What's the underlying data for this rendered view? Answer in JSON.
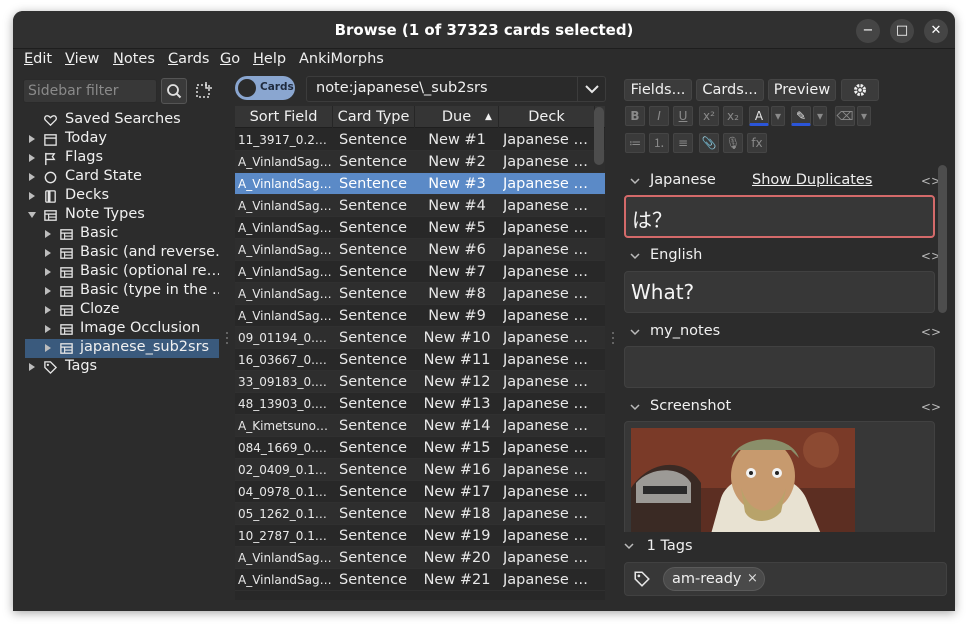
{
  "window": {
    "title": "Browse (1 of 37323 cards selected)",
    "controls": {
      "minimize": "−",
      "maximize": "□",
      "close": "✕"
    }
  },
  "menubar": [
    {
      "first": "E",
      "rest": "dit"
    },
    {
      "first": "V",
      "rest": "iew"
    },
    {
      "first": "N",
      "rest": "otes"
    },
    {
      "first": "C",
      "rest": "ards"
    },
    {
      "first": "G",
      "rest": "o"
    },
    {
      "first": "H",
      "rest": "elp"
    },
    {
      "first": "",
      "rest": "AnkiMorphs"
    }
  ],
  "sidebar": {
    "filter_placeholder": "Sidebar filter",
    "items": [
      {
        "label": "Saved Searches",
        "icon": "heart-icon",
        "level": 0,
        "expander": false
      },
      {
        "label": "Today",
        "icon": "calendar-icon",
        "level": 0,
        "expander": true
      },
      {
        "label": "Flags",
        "icon": "flag-icon",
        "level": 0,
        "expander": true
      },
      {
        "label": "Card State",
        "icon": "circle-icon",
        "level": 0,
        "expander": true
      },
      {
        "label": "Decks",
        "icon": "deck-icon",
        "level": 0,
        "expander": true
      },
      {
        "label": "Note Types",
        "icon": "notetype-icon",
        "level": 0,
        "expander": true,
        "expanded": true
      },
      {
        "label": "Basic",
        "icon": "notetype-icon",
        "level": 1,
        "expander": true
      },
      {
        "label": "Basic (and reverse…",
        "icon": "notetype-icon",
        "level": 1,
        "expander": true
      },
      {
        "label": "Basic (optional re…",
        "icon": "notetype-icon",
        "level": 1,
        "expander": true
      },
      {
        "label": "Basic (type in the …",
        "icon": "notetype-icon",
        "level": 1,
        "expander": true
      },
      {
        "label": "Cloze",
        "icon": "notetype-icon",
        "level": 1,
        "expander": true
      },
      {
        "label": "Image Occlusion",
        "icon": "notetype-icon",
        "level": 1,
        "expander": true
      },
      {
        "label": "japanese_sub2srs",
        "icon": "notetype-icon",
        "level": 1,
        "expander": true,
        "selected": true
      },
      {
        "label": "Tags",
        "icon": "tag-icon",
        "level": 0,
        "expander": true
      }
    ]
  },
  "toolbar": {
    "mode_toggle": "Cards",
    "search_value": "note:japanese\\_sub2srs"
  },
  "table": {
    "columns": [
      "Sort Field",
      "Card Type",
      "Due",
      "Deck"
    ],
    "sort_indicator": "▲",
    "rows": [
      {
        "sort": "11_3917_0.20....",
        "type": "Sentence",
        "due": "New #1",
        "deck": "Japanese …"
      },
      {
        "sort": "A_VinlandSag…",
        "type": "Sentence",
        "due": "New #2",
        "deck": "Japanese …"
      },
      {
        "sort": "A_VinlandSag…",
        "type": "Sentence",
        "due": "New #3",
        "deck": "Japanese …",
        "selected": true
      },
      {
        "sort": "A_VinlandSag…",
        "type": "Sentence",
        "due": "New #4",
        "deck": "Japanese …"
      },
      {
        "sort": "A_VinlandSag…",
        "type": "Sentence",
        "due": "New #5",
        "deck": "Japanese …"
      },
      {
        "sort": "A_VinlandSag…",
        "type": "Sentence",
        "due": "New #6",
        "deck": "Japanese …"
      },
      {
        "sort": "A_VinlandSag…",
        "type": "Sentence",
        "due": "New #7",
        "deck": "Japanese …"
      },
      {
        "sort": "A_VinlandSag…",
        "type": "Sentence",
        "due": "New #8",
        "deck": "Japanese …"
      },
      {
        "sort": "A_VinlandSag…",
        "type": "Sentence",
        "due": "New #9",
        "deck": "Japanese …"
      },
      {
        "sort": "09_01194_0.0…",
        "type": "Sentence",
        "due": "New #10",
        "deck": "Japanese …"
      },
      {
        "sort": "16_03667_0.1…",
        "type": "Sentence",
        "due": "New #11",
        "deck": "Japanese …"
      },
      {
        "sort": "33_09183_0.1…",
        "type": "Sentence",
        "due": "New #12",
        "deck": "Japanese …"
      },
      {
        "sort": "48_13903_0.1…",
        "type": "Sentence",
        "due": "New #13",
        "deck": "Japanese …"
      },
      {
        "sort": "A_KimetsunoY…",
        "type": "Sentence",
        "due": "New #14",
        "deck": "Japanese …"
      },
      {
        "sort": "084_1669_0.2…",
        "type": "Sentence",
        "due": "New #15",
        "deck": "Japanese …"
      },
      {
        "sort": "02_0409_0.17....",
        "type": "Sentence",
        "due": "New #16",
        "deck": "Japanese …"
      },
      {
        "sort": "04_0978_0.18....",
        "type": "Sentence",
        "due": "New #17",
        "deck": "Japanese …"
      },
      {
        "sort": "05_1262_0.18....",
        "type": "Sentence",
        "due": "New #18",
        "deck": "Japanese …"
      },
      {
        "sort": "10_2787_0.18....",
        "type": "Sentence",
        "due": "New #19",
        "deck": "Japanese …"
      },
      {
        "sort": "A_VinlandSag…",
        "type": "Sentence",
        "due": "New #20",
        "deck": "Japanese …"
      },
      {
        "sort": "A_VinlandSag…",
        "type": "Sentence",
        "due": "New #21",
        "deck": "Japanese …"
      }
    ]
  },
  "editor": {
    "buttons": {
      "fields": "Fields...",
      "cards": "Cards...",
      "preview": "Preview"
    },
    "format_row1": [
      "B",
      "I",
      "U",
      "x²",
      "x₂",
      "A",
      "▾",
      "✎",
      "▾",
      "⌫",
      "▾"
    ],
    "format_row2": [
      "≔",
      "⒈",
      "≡",
      "📎",
      "🎙",
      "fx"
    ],
    "fields": [
      {
        "name": "Japanese",
        "value": "は？",
        "extra": "Show Duplicates",
        "code": "<>"
      },
      {
        "name": "English",
        "value": "What?",
        "code": "<>"
      },
      {
        "name": "my_notes",
        "value": "",
        "code": "<>"
      },
      {
        "name": "Screenshot",
        "value": "",
        "code": "<>"
      }
    ],
    "tags_header": "1 Tags",
    "tags": [
      {
        "label": "am-ready",
        "remove": "×"
      }
    ]
  },
  "colors": {
    "window_bg": "#2c2c2c",
    "selection": "#5b8ac7",
    "sidebar_selection": "#3a5a7d",
    "focus_border": "#d46a6a",
    "toggle": "#8aa6d0"
  }
}
